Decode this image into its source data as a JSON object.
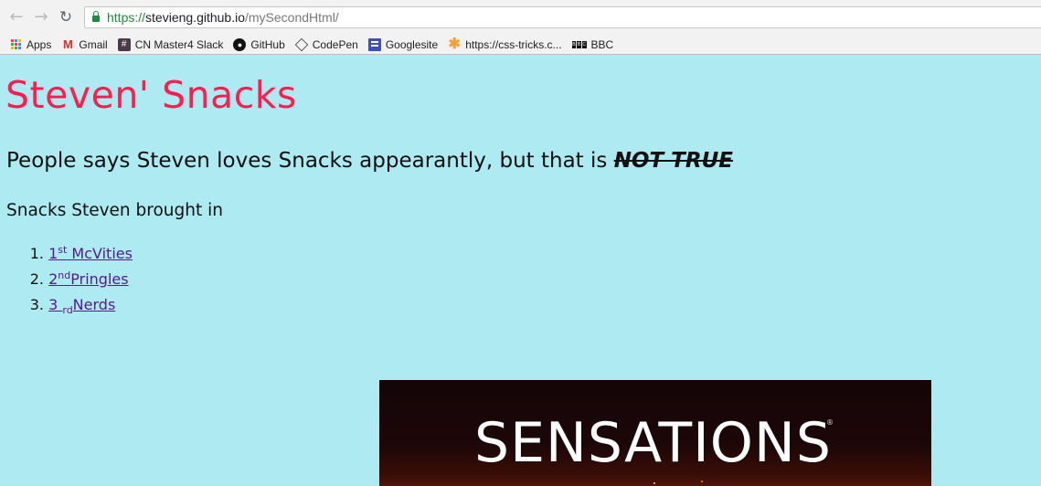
{
  "browser": {
    "url_scheme": "https://",
    "url_host": "stevieng.github.io",
    "url_path": "/mySecondHtml/",
    "nav": {
      "back": "←",
      "forward": "→",
      "reload": "↻"
    }
  },
  "bookmarks": [
    {
      "label": "Apps",
      "icon": "apps-grid-icon"
    },
    {
      "label": "Gmail",
      "icon": "gmail-icon"
    },
    {
      "label": "CN Master4 Slack",
      "icon": "slack-hash-icon"
    },
    {
      "label": "GitHub",
      "icon": "github-icon"
    },
    {
      "label": "CodePen",
      "icon": "codepen-icon"
    },
    {
      "label": "Googlesite",
      "icon": "google-sites-icon"
    },
    {
      "label": "https://css-tricks.c...",
      "icon": "css-tricks-asterisk-icon"
    },
    {
      "label": "BBC",
      "icon": "bbc-icon"
    }
  ],
  "page": {
    "title": "Steven' Snacks",
    "claim_text": "People says Steven loves Snacks appearantly, but that is ",
    "claim_struck": "NOT TRUE",
    "section_heading": "Snacks Steven brought in",
    "snacks": [
      {
        "number": "1.",
        "ordinal": "1",
        "suffix": "st",
        "name": " McVities"
      },
      {
        "number": "2.",
        "ordinal": "2",
        "suffix": "nd",
        "name": "Pringles"
      },
      {
        "number": "3.",
        "ordinal": "3 ",
        "suffix": "rd",
        "name": "Nerds"
      }
    ],
    "image_brand": "SENSATIONS",
    "image_brand_mark": "®"
  },
  "colors": {
    "page_background": "#aeeaf2",
    "title": "#ff1c4f",
    "link_visited": "#551a8b",
    "secure_green": "#1e8e3e"
  }
}
